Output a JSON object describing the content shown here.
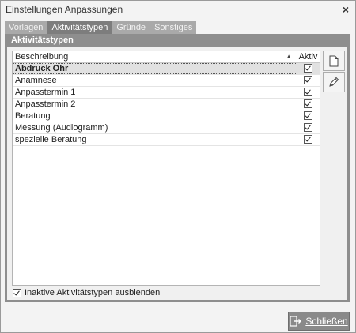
{
  "window": {
    "title": "Einstellungen Anpassungen",
    "close_glyph": "×"
  },
  "tabs": [
    {
      "label": "Vorlagen",
      "active": false
    },
    {
      "label": "Aktivitätstypen",
      "active": true
    },
    {
      "label": "Gründe",
      "active": false
    },
    {
      "label": "Sonstiges",
      "active": false
    }
  ],
  "panel": {
    "title": "Aktivitätstypen"
  },
  "grid": {
    "columns": {
      "description": "Beschreibung",
      "active": "Aktiv"
    },
    "rows": [
      {
        "description": "Abdruck Ohr",
        "active": true,
        "selected": true
      },
      {
        "description": "Anamnese",
        "active": true
      },
      {
        "description": "Anpasstermin 1",
        "active": true
      },
      {
        "description": "Anpasstermin 2",
        "active": true
      },
      {
        "description": "Beratung",
        "active": true
      },
      {
        "description": "Messung (Audiogramm)",
        "active": true
      },
      {
        "description": "spezielle Beratung",
        "active": true
      }
    ]
  },
  "side_buttons": [
    {
      "icon": "new-document-icon"
    },
    {
      "icon": "pencil-icon"
    }
  ],
  "footer": {
    "hide_inactive_label": "Inaktive Aktivitätstypen ausblenden",
    "hide_inactive_checked": true
  },
  "actions": {
    "close_label": "Schließen",
    "close_icon": "exit-icon"
  },
  "colors": {
    "tab_active": "#7d7d7d",
    "tab_inactive": "#a9a9a9",
    "panel_header": "#8e8e8e",
    "close_button": "#8a8a8a"
  }
}
